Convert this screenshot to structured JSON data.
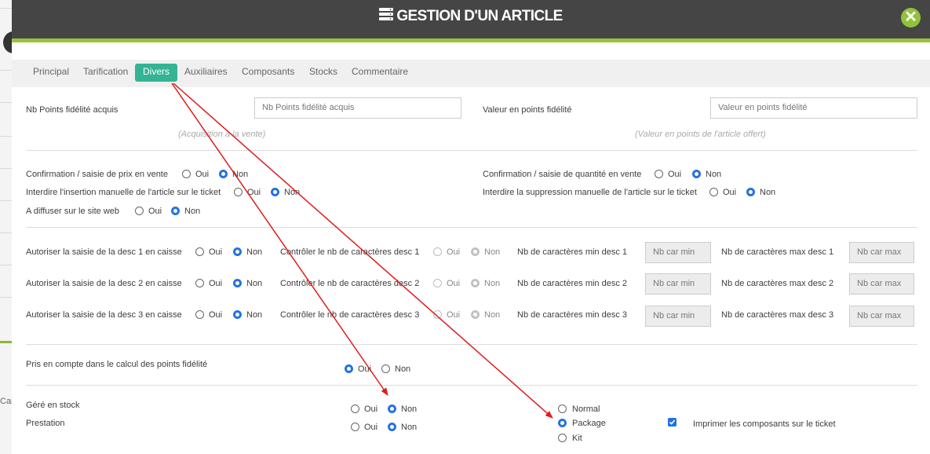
{
  "modal": {
    "title": "GESTION D'UN ARTICLE",
    "icon": "database-icon",
    "close_icon": "close-icon",
    "accent_color": "#9ac43c",
    "header_color": "#454545"
  },
  "tabs": [
    {
      "label": "Principal",
      "active": false
    },
    {
      "label": "Tarification",
      "active": false
    },
    {
      "label": "Divers",
      "active": true
    },
    {
      "label": "Auxiliaires",
      "active": false
    },
    {
      "label": "Composants",
      "active": false
    },
    {
      "label": "Stocks",
      "active": false
    },
    {
      "label": "Commentaire",
      "active": false
    }
  ],
  "fidelity": {
    "points_label": "Nb Points fidélité acquis",
    "points_placeholder": "Nb Points fidélité acquis",
    "points_hint": "(Acquisition à la vente)",
    "value_label": "Valeur en points fidélité",
    "value_placeholder": "Valeur en points fidélité",
    "value_hint": "(Valeur en points de l'article offert)"
  },
  "options": {
    "oui": "Oui",
    "non": "Non",
    "confirm_price": "Confirmation / saisie de prix en vente",
    "confirm_qty": "Confirmation / saisie de quantité en vente",
    "forbid_insert": "Interdire l'insertion manuelle de l'article sur le ticket",
    "forbid_delete": "Interdire la suppression manuelle de l'article sur le ticket",
    "website": "A diffuser sur le site web"
  },
  "descs": {
    "rows": [
      {
        "allow": "Autoriser la saisie de la desc 1 en caisse",
        "control": "Contrôler le nb de caractères desc 1",
        "min": "Nb de caractères min desc 1",
        "max": "Nb de caractères max desc 1"
      },
      {
        "allow": "Autoriser la saisie de la desc 2 en caisse",
        "control": "Contrôler le nb de caractères desc 2",
        "min": "Nb de caractères min desc 2",
        "max": "Nb de caractères max desc 2"
      },
      {
        "allow": "Autoriser la saisie de la desc 3 en caisse",
        "control": "Contrôler le nb de caractères desc 3",
        "min": "Nb de caractères min desc 3",
        "max": "Nb de caractères max desc 3"
      }
    ],
    "min_placeholder": "Nb car min",
    "max_placeholder": "Nb car max"
  },
  "loyalty": {
    "label": "Pris en compte dans le calcul des points fidélité"
  },
  "stock": {
    "managed_label": "Géré en stock",
    "service_label": "Prestation",
    "type_options": [
      "Normal",
      "Package",
      "Kit"
    ],
    "type_selected": "Package",
    "print_components": "Imprimer les composants sur le ticket",
    "print_components_checked": true
  },
  "annotation": {
    "arrow_color": "#e01b1b"
  },
  "backdrop": {
    "text": "Car"
  }
}
